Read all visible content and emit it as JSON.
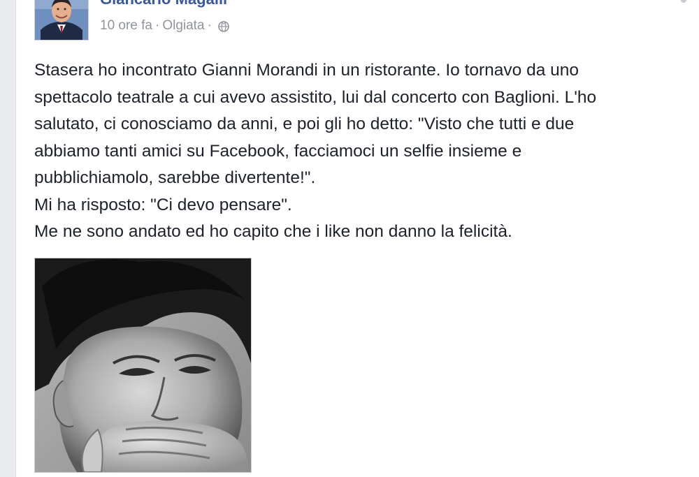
{
  "post": {
    "author": "Giancarlo Magalli",
    "time": "10 ore fa",
    "separator": "·",
    "location": "Olgiata",
    "privacy_icon": "globe-icon",
    "body_lines": [
      "Stasera ho incontrato Gianni Morandi in un ristorante. Io tornavo da uno",
      "spettacolo teatrale a cui avevo assistito, lui dal concerto con Baglioni. L'ho",
      "salutato, ci conosciamo da anni, e poi gli ho detto: \"Visto che tutti e due",
      "abbiamo tanti amici su Facebook, facciamoci un selfie insieme e",
      "pubblichiamolo, sarebbe divertente!\".",
      "Mi ha risposto: \"Ci devo pensare\".",
      "Me ne sono andato ed ho capito che i like non danno la felicità."
    ]
  },
  "colors": {
    "author_link": "#3b5998",
    "meta_text": "#90949c",
    "body_text": "#1d2129",
    "page_background": "#ffffff",
    "side_strip": "#e9ebee"
  }
}
